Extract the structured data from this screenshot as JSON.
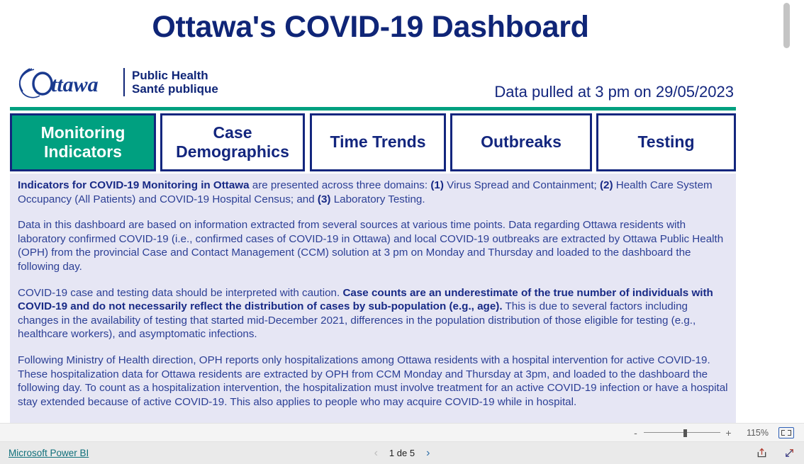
{
  "report": {
    "title": "Ottawa's COVID-19 Dashboard",
    "logo": {
      "wordmark": "Ottawa",
      "line1": "Public Health",
      "line2": "Santé publique"
    },
    "pull_date": "Data pulled at 3 pm on 29/05/2023",
    "accent_green": "#00a080",
    "navy": "#13267e",
    "panel_background": "#e6e6f4",
    "tabs": [
      {
        "label": "Monitoring\nIndicators",
        "active": true
      },
      {
        "label": "Case\nDemographics",
        "active": false
      },
      {
        "label": "Time Trends",
        "active": false
      },
      {
        "label": "Outbreaks",
        "active": false
      },
      {
        "label": "Testing",
        "active": false
      }
    ],
    "paragraphs": [
      {
        "runs": [
          {
            "text": "Indicators for COVID-19 Monitoring in Ottawa",
            "bold": true
          },
          {
            "text": " are presented across three domains: ",
            "bold": false
          },
          {
            "text": "(1)",
            "bold": true
          },
          {
            "text": " Virus Spread and Containment; ",
            "bold": false
          },
          {
            "text": "(2)",
            "bold": true
          },
          {
            "text": " Health Care System Occupancy (All Patients) and COVID-19 Hospital Census; and ",
            "bold": false
          },
          {
            "text": "(3)",
            "bold": true
          },
          {
            "text": " Laboratory Testing.",
            "bold": false
          }
        ]
      },
      {
        "runs": [
          {
            "text": "Data in this dashboard are based on information extracted from several sources at various time points. Data regarding Ottawa residents with laboratory confirmed COVID-19 (i.e., confirmed cases of COVID-19 in Ottawa) and local COVID-19 outbreaks are extracted by Ottawa Public Health (OPH) from the provincial Case and Contact Management (CCM) solution at 3 pm on Monday and Thursday and loaded to the dashboard the following day.",
            "bold": false
          }
        ]
      },
      {
        "runs": [
          {
            "text": "COVID-19 case and testing data should be interpreted with caution. ",
            "bold": false
          },
          {
            "text": "Case counts are an underestimate of the true number of individuals with COVID-19 and do not necessarily reflect the distribution of cases by sub-population (e.g., age).",
            "bold": true
          },
          {
            "text": " This is due to several factors including changes in the availability of testing that started mid-December 2021, differences in the population distribution of those eligible for testing (e.g., healthcare workers), and asymptomatic infections.",
            "bold": false
          }
        ]
      },
      {
        "runs": [
          {
            "text": "Following Ministry of Health direction, OPH reports only hospitalizations among Ottawa residents with a hospital intervention for active COVID-19. These hospitalization data for Ottawa residents are extracted by OPH from CCM Monday and Thursday at 3pm, and loaded to the dashboard the following day. To count as a hospitalization intervention, the hospitalization must involve treatment for an active COVID-19 infection or have a hospital stay extended because of active COVID-19. This also applies to people who may acquire COVID-19 while in hospital.",
            "bold": false
          }
        ]
      }
    ]
  },
  "zoombar": {
    "minus_label": "-",
    "plus_label": "+",
    "zoom_level": "115%",
    "fit_icon": "fit-to-page-icon"
  },
  "statusbar": {
    "powerbi_label": "Microsoft Power BI",
    "page_indicator": "1 de 5",
    "prev_icon": "chevron-left-icon",
    "next_icon": "chevron-right-icon",
    "share_icon": "share-icon",
    "fullscreen_icon": "fullscreen-icon"
  }
}
